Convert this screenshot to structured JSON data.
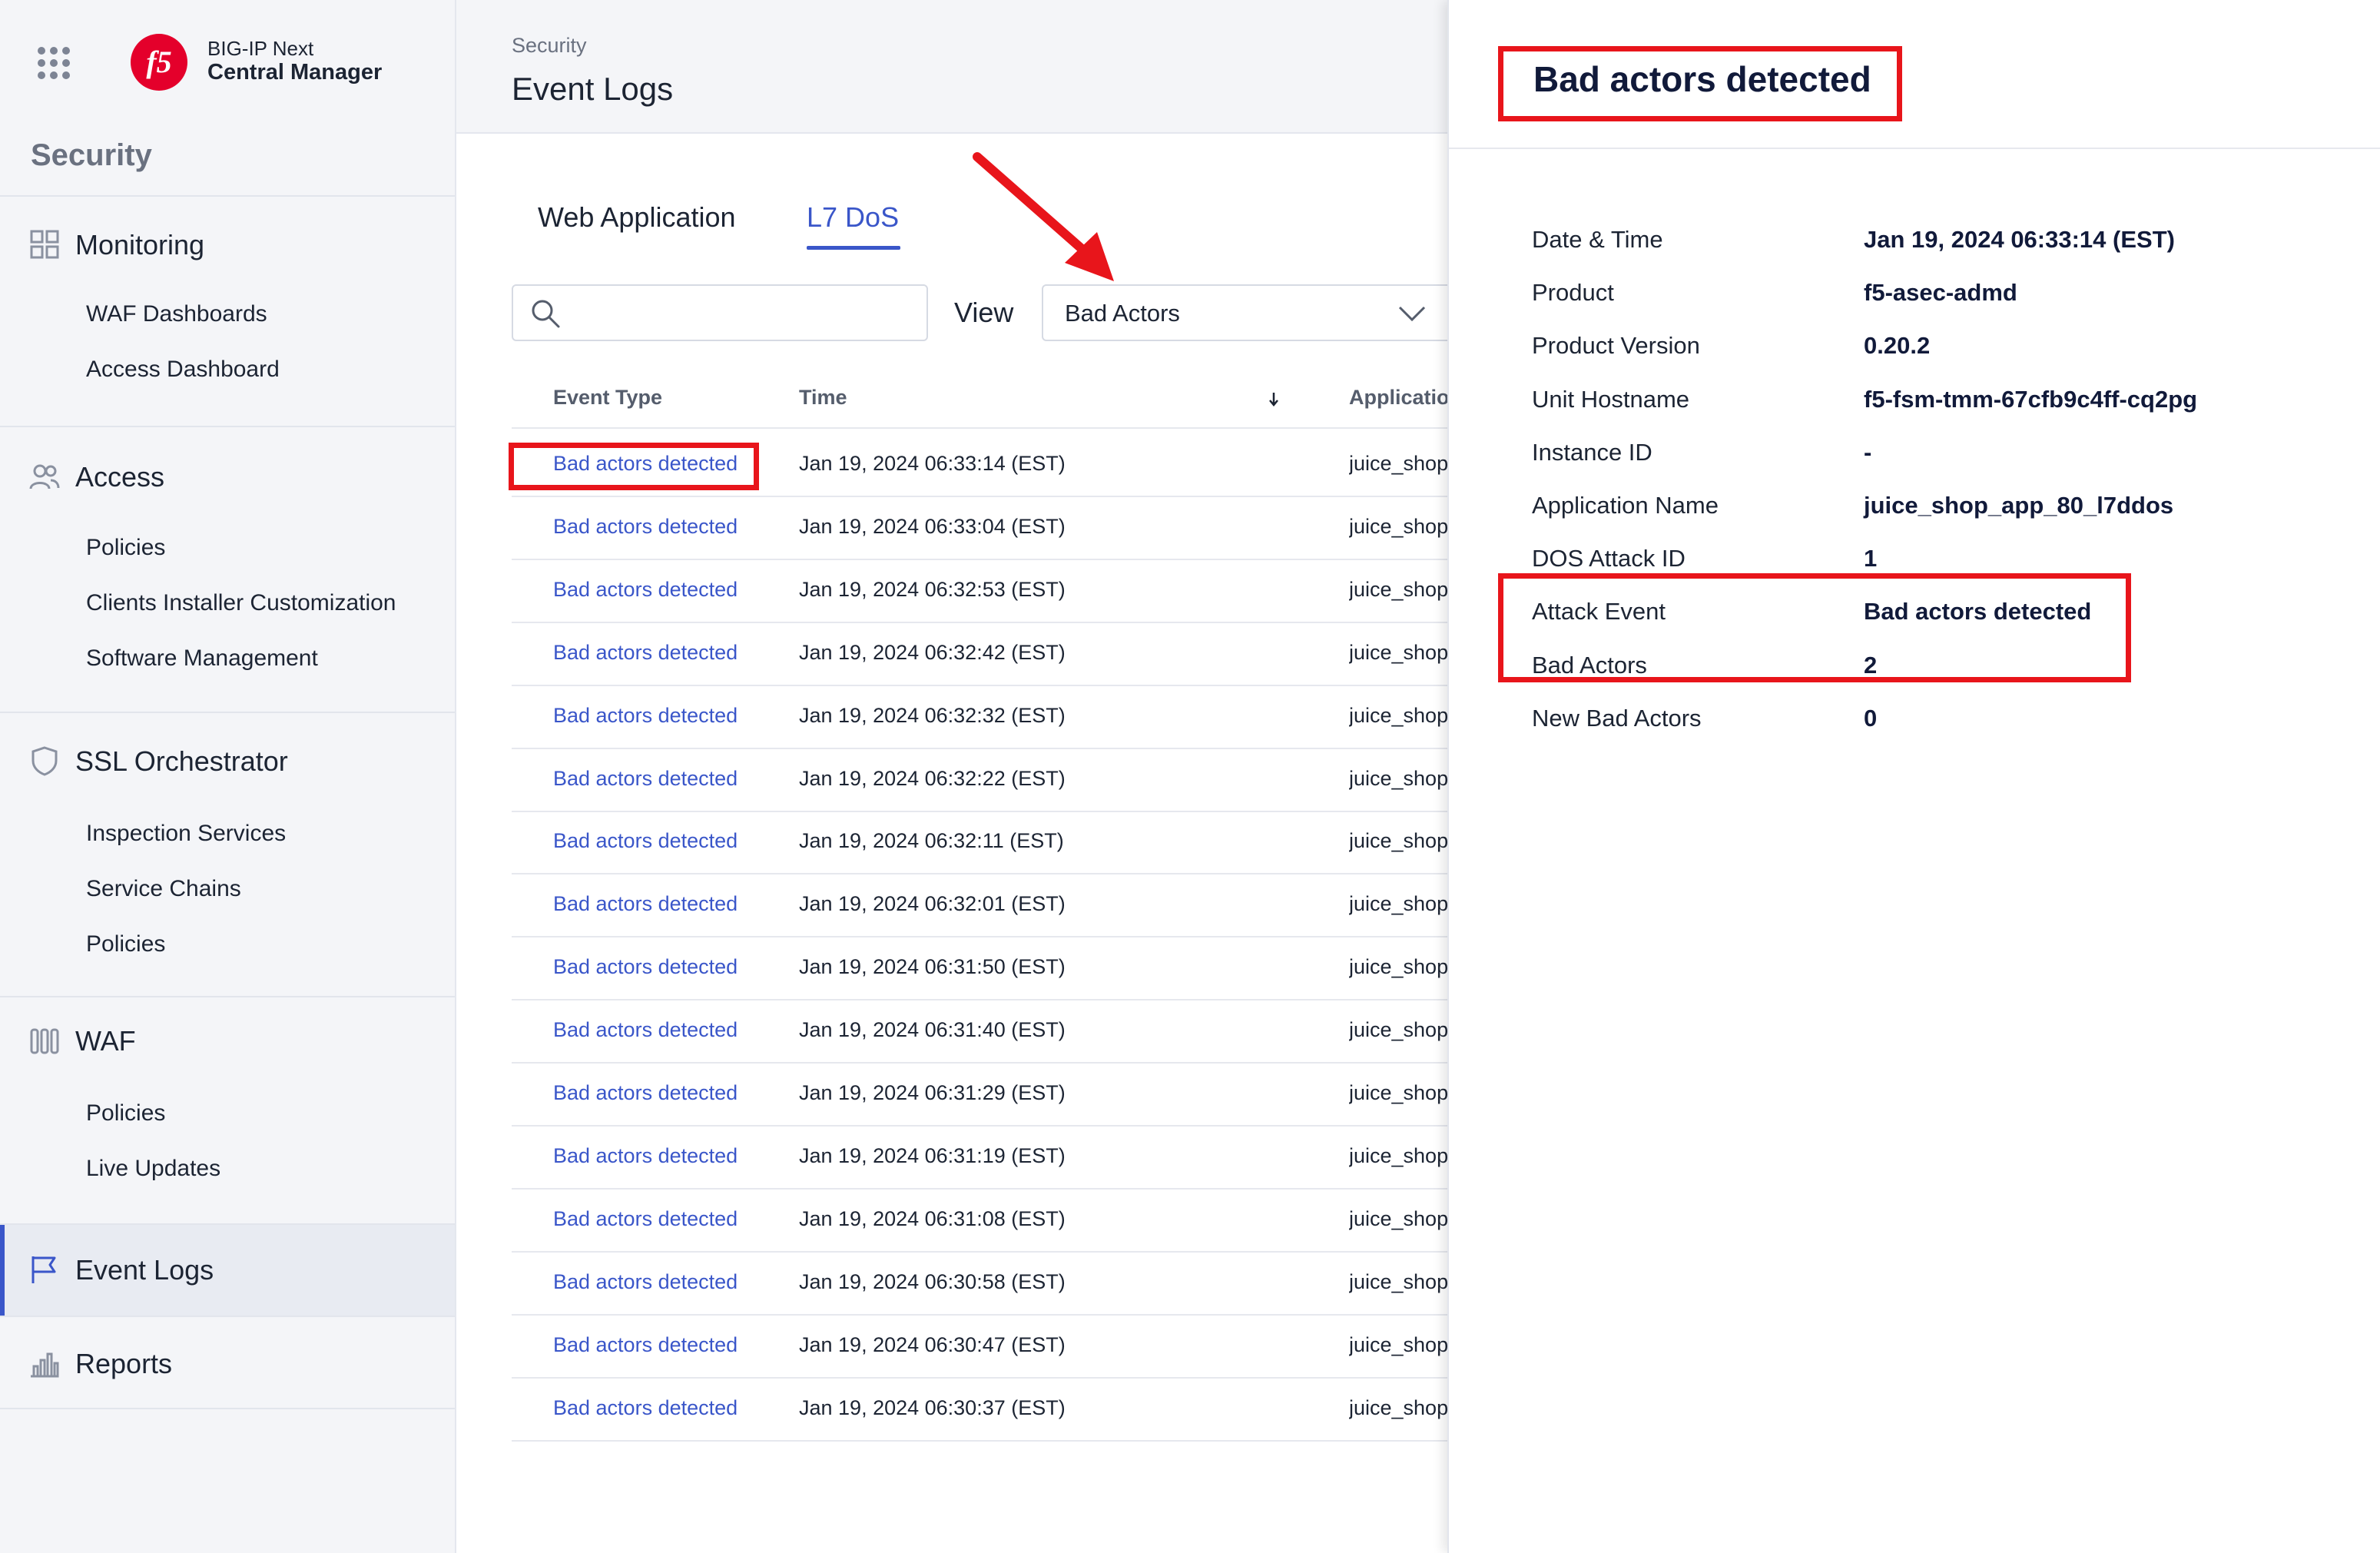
{
  "app": {
    "brand_line1": "BIG-IP Next",
    "brand_line2": "Central Manager",
    "logo_text": "f5"
  },
  "sidebar": {
    "title": "Security",
    "sections": [
      {
        "label": "Monitoring",
        "icon": "grid-icon",
        "items": [
          "WAF Dashboards",
          "Access Dashboard"
        ]
      },
      {
        "label": "Access",
        "icon": "users-icon",
        "items": [
          "Policies",
          "Clients Installer Customization",
          "Software Management"
        ]
      },
      {
        "label": "SSL Orchestrator",
        "icon": "shield-icon",
        "items": [
          "Inspection Services",
          "Service Chains",
          "Policies"
        ]
      },
      {
        "label": "WAF",
        "icon": "waf-icon",
        "items": [
          "Policies",
          "Live Updates"
        ]
      }
    ],
    "event_logs": "Event Logs",
    "reports": "Reports"
  },
  "header": {
    "breadcrumb": "Security",
    "title": "Event Logs"
  },
  "tabs": [
    "Web Application",
    "L7 DoS"
  ],
  "active_tab": "L7 DoS",
  "search": {
    "placeholder": "",
    "value": ""
  },
  "view": {
    "label": "View",
    "selected": "Bad Actors"
  },
  "table": {
    "columns": [
      "Event Type",
      "Time",
      "Applicatio"
    ],
    "rows": [
      {
        "event": "Bad actors detected",
        "time": "Jan 19, 2024 06:33:14 (EST)",
        "app": "juice_shop_"
      },
      {
        "event": "Bad actors detected",
        "time": "Jan 19, 2024 06:33:04 (EST)",
        "app": "juice_shop_"
      },
      {
        "event": "Bad actors detected",
        "time": "Jan 19, 2024 06:32:53 (EST)",
        "app": "juice_shop_"
      },
      {
        "event": "Bad actors detected",
        "time": "Jan 19, 2024 06:32:42 (EST)",
        "app": "juice_shop_"
      },
      {
        "event": "Bad actors detected",
        "time": "Jan 19, 2024 06:32:32 (EST)",
        "app": "juice_shop_"
      },
      {
        "event": "Bad actors detected",
        "time": "Jan 19, 2024 06:32:22 (EST)",
        "app": "juice_shop_"
      },
      {
        "event": "Bad actors detected",
        "time": "Jan 19, 2024 06:32:11 (EST)",
        "app": "juice_shop_"
      },
      {
        "event": "Bad actors detected",
        "time": "Jan 19, 2024 06:32:01 (EST)",
        "app": "juice_shop_"
      },
      {
        "event": "Bad actors detected",
        "time": "Jan 19, 2024 06:31:50 (EST)",
        "app": "juice_shop_"
      },
      {
        "event": "Bad actors detected",
        "time": "Jan 19, 2024 06:31:40 (EST)",
        "app": "juice_shop_"
      },
      {
        "event": "Bad actors detected",
        "time": "Jan 19, 2024 06:31:29 (EST)",
        "app": "juice_shop_"
      },
      {
        "event": "Bad actors detected",
        "time": "Jan 19, 2024 06:31:19 (EST)",
        "app": "juice_shop_"
      },
      {
        "event": "Bad actors detected",
        "time": "Jan 19, 2024 06:31:08 (EST)",
        "app": "juice_shop_"
      },
      {
        "event": "Bad actors detected",
        "time": "Jan 19, 2024 06:30:58 (EST)",
        "app": "juice_shop_"
      },
      {
        "event": "Bad actors detected",
        "time": "Jan 19, 2024 06:30:47 (EST)",
        "app": "juice_shop_"
      },
      {
        "event": "Bad actors detected",
        "time": "Jan 19, 2024 06:30:37 (EST)",
        "app": "juice_shop_"
      }
    ]
  },
  "detail": {
    "title": "Bad actors detected",
    "fields": [
      {
        "label": "Date & Time",
        "value": "Jan 19, 2024 06:33:14 (EST)"
      },
      {
        "label": "Product",
        "value": "f5-asec-admd"
      },
      {
        "label": "Product Version",
        "value": "0.20.2"
      },
      {
        "label": "Unit Hostname",
        "value": "f5-fsm-tmm-67cfb9c4ff-cq2pg"
      },
      {
        "label": "Instance ID",
        "value": "-"
      },
      {
        "label": "Application Name",
        "value": "juice_shop_app_80_l7ddos"
      },
      {
        "label": "DOS Attack ID",
        "value": "1"
      },
      {
        "label": "Attack Event",
        "value": "Bad actors detected"
      },
      {
        "label": "Bad Actors",
        "value": "2"
      },
      {
        "label": "New Bad Actors",
        "value": "0"
      }
    ]
  },
  "colors": {
    "accent": "#3a56c9",
    "annotation": "#e8151b",
    "brand_red": "#e4002b",
    "sidebar_bg": "#f4f5f8"
  }
}
